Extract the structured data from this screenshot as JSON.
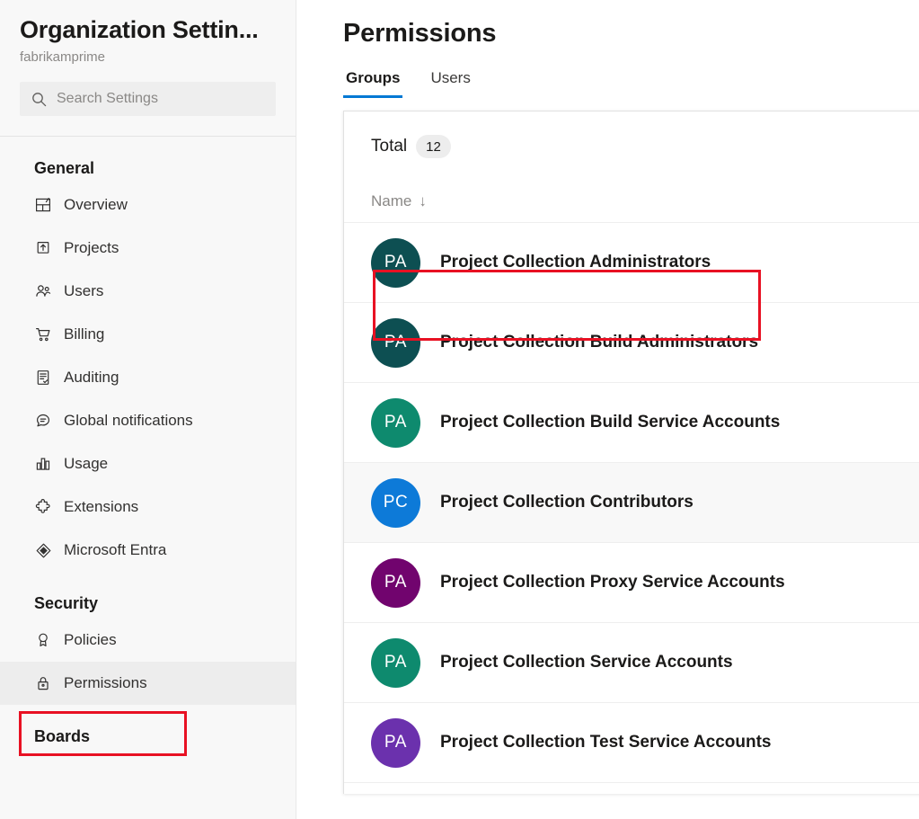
{
  "sidebar": {
    "title": "Organization Settin...",
    "subtitle": "fabrikamprime",
    "search": {
      "placeholder": "Search Settings",
      "value": "",
      "icon": "search-icon"
    },
    "sections": [
      {
        "heading": "General",
        "items": [
          {
            "label": "Overview",
            "icon": "overview-icon",
            "selected": false
          },
          {
            "label": "Projects",
            "icon": "projects-icon",
            "selected": false
          },
          {
            "label": "Users",
            "icon": "users-icon",
            "selected": false
          },
          {
            "label": "Billing",
            "icon": "billing-cart-icon",
            "selected": false
          },
          {
            "label": "Auditing",
            "icon": "auditing-icon",
            "selected": false
          },
          {
            "label": "Global notifications",
            "icon": "notifications-icon",
            "selected": false
          },
          {
            "label": "Usage",
            "icon": "usage-chart-icon",
            "selected": false
          },
          {
            "label": "Extensions",
            "icon": "extensions-puzzle-icon",
            "selected": false
          },
          {
            "label": "Microsoft Entra",
            "icon": "microsoft-entra-icon",
            "selected": false
          }
        ]
      },
      {
        "heading": "Security",
        "items": [
          {
            "label": "Policies",
            "icon": "policies-ribbon-icon",
            "selected": false
          },
          {
            "label": "Permissions",
            "icon": "permissions-lock-icon",
            "selected": true
          }
        ]
      },
      {
        "heading": "Boards",
        "items": []
      }
    ],
    "scrollbar": {
      "name": "sidebar-scrollbar"
    }
  },
  "main": {
    "title": "Permissions",
    "tabs": [
      {
        "label": "Groups",
        "active": true
      },
      {
        "label": "Users",
        "active": false
      }
    ],
    "total": {
      "label": "Total",
      "count": "12"
    },
    "columns": [
      {
        "label": "Name",
        "sort": "↓"
      }
    ],
    "groups": [
      {
        "initials": "PA",
        "name": "Project Collection Administrators",
        "color": "#0d4f52",
        "shaded": false,
        "highlighted": true
      },
      {
        "initials": "PA",
        "name": "Project Collection Build Administrators",
        "color": "#0d4f52",
        "shaded": false,
        "highlighted": false
      },
      {
        "initials": "PA",
        "name": "Project Collection Build Service Accounts",
        "color": "#0e8a6e",
        "shaded": false,
        "highlighted": false
      },
      {
        "initials": "PC",
        "name": "Project Collection Contributors",
        "color": "#0d7ad8",
        "shaded": true,
        "highlighted": false
      },
      {
        "initials": "PA",
        "name": "Project Collection Proxy Service Accounts",
        "color": "#71046e",
        "shaded": false,
        "highlighted": false
      },
      {
        "initials": "PA",
        "name": "Project Collection Service Accounts",
        "color": "#0e8a6e",
        "shaded": false,
        "highlighted": false
      },
      {
        "initials": "PA",
        "name": "Project Collection Test Service Accounts",
        "color": "#6b31ad",
        "shaded": false,
        "highlighted": false
      }
    ]
  },
  "annotations": {
    "accent": "#e81123",
    "boxes": [
      {
        "name": "highlight-permissions-nav"
      },
      {
        "name": "highlight-project-collection-administrators-row"
      }
    ]
  }
}
